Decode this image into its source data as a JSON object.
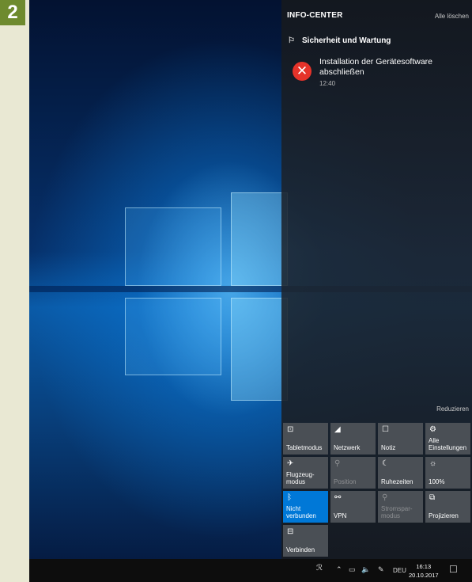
{
  "step_number": "2",
  "info_center": {
    "title": "INFO-CENTER",
    "clear_all": "Alle löschen",
    "group": {
      "icon": "security-flag-icon",
      "title": "Sicherheit und Wartung"
    },
    "notification": {
      "icon": "error-icon",
      "title": "Installation der Gerätesoftware abschließen",
      "time": "12:40"
    },
    "collapse_label": "Reduzieren"
  },
  "quick_actions": [
    {
      "label": "Tabletmodus",
      "icon": "tablet-mode-icon",
      "glyph": "⊡",
      "state": "normal"
    },
    {
      "label": "Netzwerk",
      "icon": "network-icon",
      "glyph": "◢",
      "state": "normal"
    },
    {
      "label": "Notiz",
      "icon": "note-icon",
      "glyph": "☐",
      "state": "normal"
    },
    {
      "label": "Alle\nEinstellungen",
      "icon": "settings-gear-icon",
      "glyph": "⚙",
      "state": "normal"
    },
    {
      "label": "Flugzeug-\nmodus",
      "icon": "airplane-icon",
      "glyph": "✈",
      "state": "normal"
    },
    {
      "label": "Position",
      "icon": "location-icon",
      "glyph": "⚲",
      "state": "disabled"
    },
    {
      "label": "Ruhezeiten",
      "icon": "moon-icon",
      "glyph": "☾",
      "state": "normal"
    },
    {
      "label": "100%",
      "icon": "brightness-icon",
      "glyph": "☼",
      "state": "normal"
    },
    {
      "label": "Nicht\nverbunden",
      "icon": "bluetooth-icon",
      "glyph": "ᛒ",
      "state": "active"
    },
    {
      "label": "VPN",
      "icon": "vpn-icon",
      "glyph": "⚯",
      "state": "normal"
    },
    {
      "label": "Stromspar-\nmodus",
      "icon": "battery-saver-icon",
      "glyph": "⚲",
      "state": "disabled"
    },
    {
      "label": "Projizieren",
      "icon": "project-icon",
      "glyph": "⧉",
      "state": "normal"
    },
    {
      "label": "Verbinden",
      "icon": "connect-icon",
      "glyph": "⊟",
      "state": "normal"
    }
  ],
  "taskbar": {
    "language": "DEU",
    "time": "16:13",
    "date": "20.10.2017"
  },
  "colors": {
    "accent": "#0078d7",
    "tile": "#4a4f55",
    "error": "#e6332a",
    "badge": "#6e8a2e"
  }
}
